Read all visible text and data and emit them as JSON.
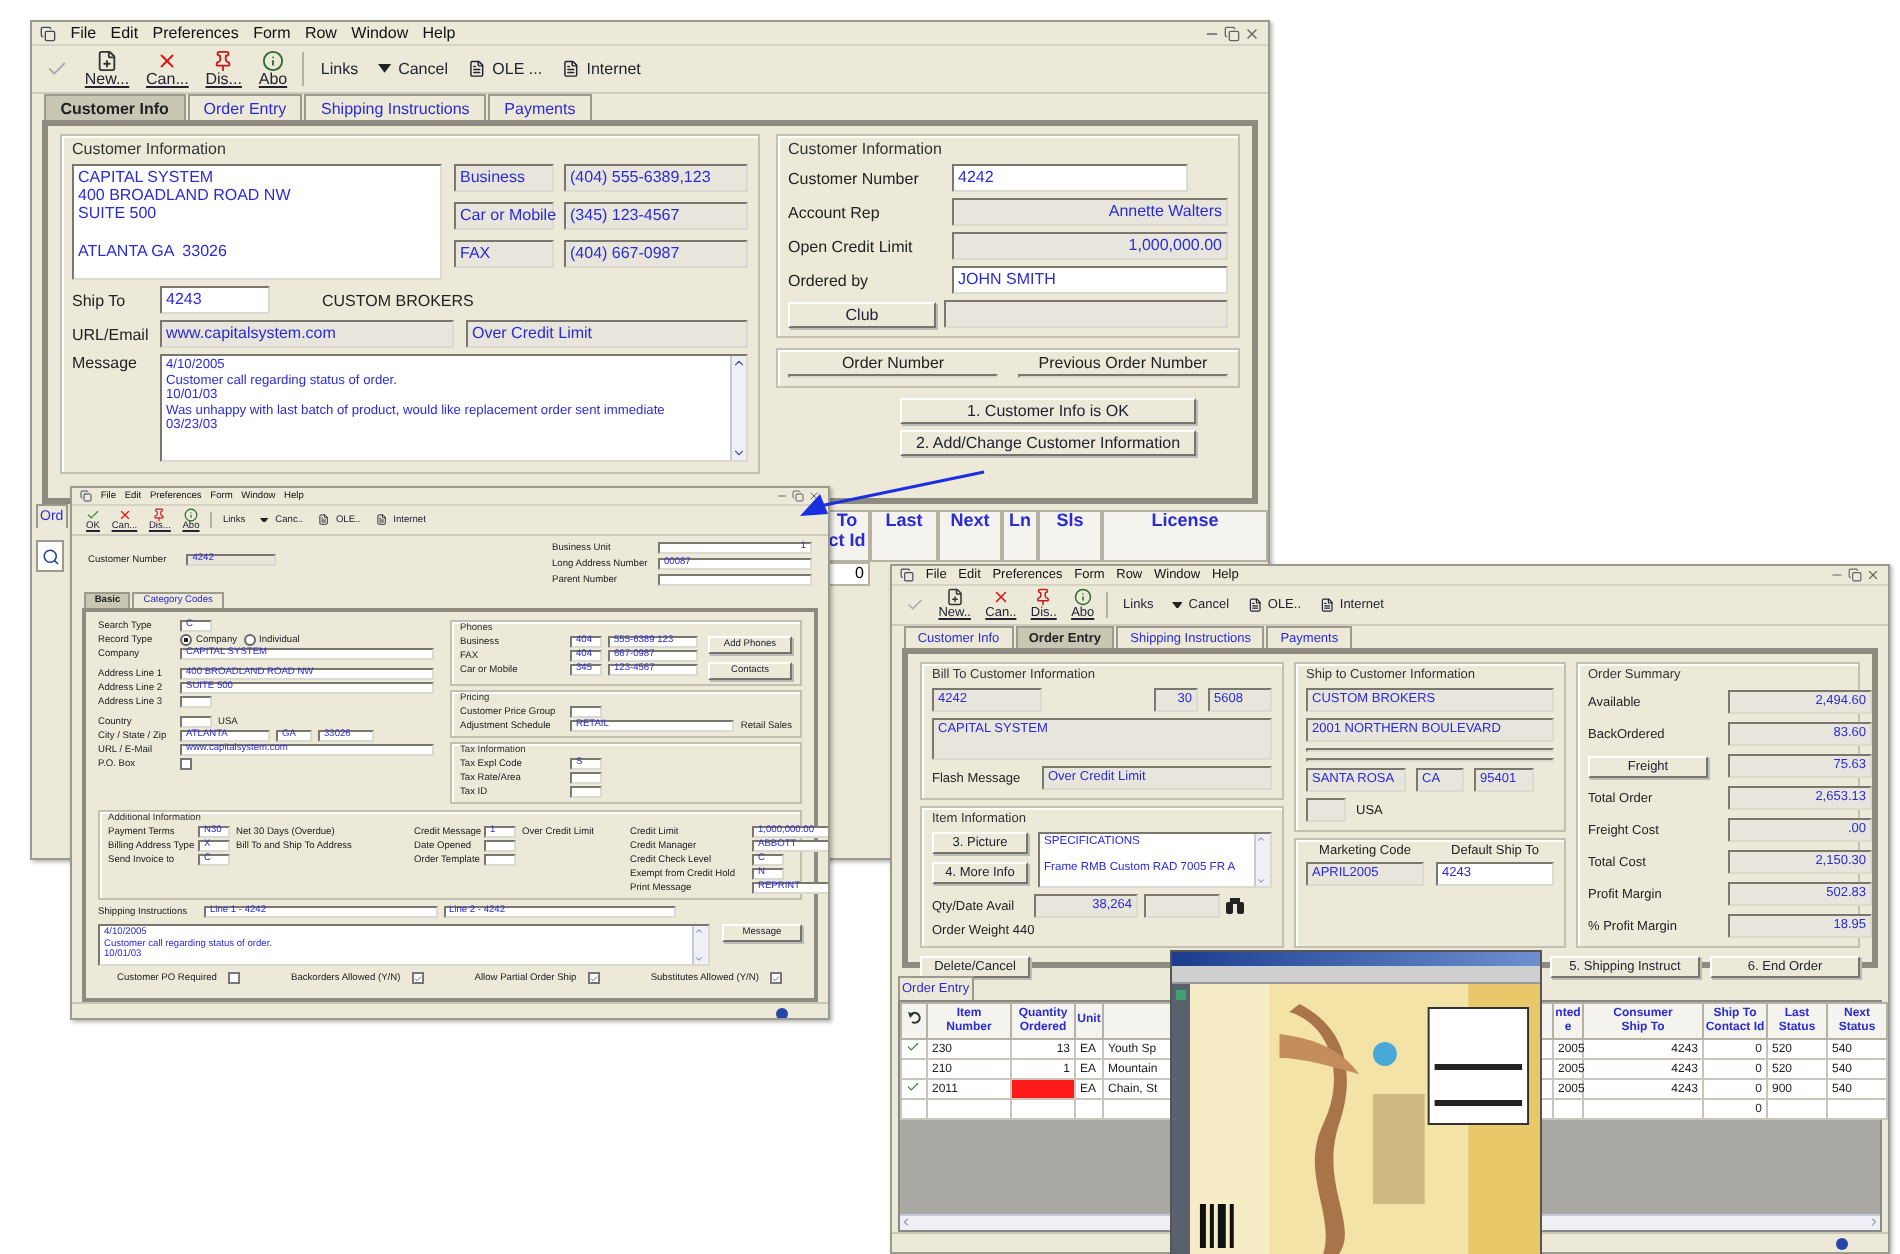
{
  "customer_window": {
    "menu": [
      "File",
      "Edit",
      "Preferences",
      "Form",
      "Row",
      "Window",
      "Help"
    ],
    "toolbar": [
      {
        "kind": "ok",
        "disabled": true
      },
      {
        "kind": "new",
        "label": "New..."
      },
      {
        "kind": "cancel",
        "label": "Can..."
      },
      {
        "kind": "display",
        "label": "Dis..."
      },
      {
        "kind": "about",
        "label": "Abo"
      }
    ],
    "links": "Links",
    "cancel": "Cancel",
    "ole": "OLE ...",
    "internet": "Internet",
    "tabs": [
      {
        "label": "Customer Info",
        "selected": true
      },
      {
        "label": "Order Entry",
        "selected": false
      },
      {
        "label": "Shipping Instructions",
        "selected": false
      },
      {
        "label": "Payments",
        "selected": false
      }
    ],
    "info": {
      "legend": "Customer Information",
      "address": [
        "CAPITAL SYSTEM",
        "400 BROADLAND ROAD NW",
        "SUITE 500"
      ],
      "city_line": "ATLANTA GA  33026",
      "phones": [
        {
          "type": "Business",
          "number": "(404) 555-6389,123"
        },
        {
          "type": "Car or Mobile",
          "number": "(345) 123-4567"
        },
        {
          "type": "FAX",
          "number": "(404) 667-0987"
        }
      ],
      "ship_to": {
        "label": "Ship To",
        "value": "4243",
        "editable": true,
        "name": "CUSTOM BROKERS"
      },
      "url": {
        "label": "URL/Email",
        "value": "www.capitalsystem.com",
        "flag": "Over Credit Limit"
      },
      "message": {
        "label": "Message",
        "lines": [
          "4/10/2005",
          "Customer call regarding status of order.",
          "10/01/03",
          "Was unhappy with last batch of product, would like replacement order sent immediate",
          "03/23/03"
        ]
      }
    },
    "account": {
      "legend": "Customer Information",
      "fields": [
        {
          "label": "Customer Number",
          "value": "4242",
          "editable": true
        },
        {
          "label": "Account Rep",
          "value": "Annette Walters",
          "editable": false
        },
        {
          "label": "Open Credit Limit",
          "value": "1,000,000.00",
          "editable": false
        },
        {
          "label": "Ordered by",
          "value": "JOHN SMITH",
          "editable": true
        }
      ],
      "club": "Club"
    },
    "order_numbers": [
      "Order Number",
      "Previous Order Number"
    ],
    "actions": [
      "1. Customer Info is OK",
      "2. Add/Change Customer Information"
    ],
    "grid": {
      "tab": "Ord",
      "columns": [
        "To\nct Id",
        "Last",
        "Next",
        "Ln",
        "Sls",
        "License"
      ],
      "value": "0"
    }
  },
  "address_window": {
    "menu": [
      "File",
      "Edit",
      "Preferences",
      "Form",
      "Window",
      "Help"
    ],
    "toolbar": [
      {
        "kind": "ok",
        "label": "OK"
      },
      {
        "kind": "cancel",
        "label": "Can..."
      },
      {
        "kind": "display",
        "label": "Dis..."
      },
      {
        "kind": "about",
        "label": "Abo"
      }
    ],
    "links": "Links",
    "cancel": "Canc..",
    "ole": "OLE..",
    "internet": "Internet",
    "header_left": [
      {
        "label": "Customer Number",
        "value": "4242"
      }
    ],
    "header_right": [
      {
        "label": "Business Unit",
        "value": "1"
      },
      {
        "label": "Long Address Number",
        "value": "00087"
      },
      {
        "label": "Parent Number"
      }
    ],
    "tabs": [
      {
        "label": "Basic",
        "selected": true
      },
      {
        "label": "Category Codes",
        "selected": false
      }
    ],
    "left_rows": [
      {
        "kind": "field",
        "label": "Search Type",
        "values": [
          "C"
        ]
      },
      {
        "kind": "radio",
        "label": "Record Type",
        "options": [
          {
            "label": "Company",
            "selected": true
          },
          {
            "label": "Individual",
            "selected": false
          }
        ]
      },
      {
        "kind": "field",
        "label": "Company",
        "values": [
          "CAPITAL SYSTEM"
        ]
      },
      {
        "kind": "field",
        "label": "Address Line 1",
        "values": [
          "400 BROADLAND ROAD NW"
        ]
      },
      {
        "kind": "field",
        "label": "Address Line 2",
        "values": [
          "SUITE 500"
        ]
      },
      {
        "kind": "field",
        "label": "Address Line 3"
      },
      {
        "kind": "field",
        "label": "Country",
        "note": "USA"
      },
      {
        "kind": "field",
        "label": "City / State / Zip",
        "values": [
          "ATLANTA",
          "GA",
          "33026"
        ]
      },
      {
        "kind": "field",
        "label": "URL / E-Mail",
        "values": [
          "www.capitalsystem.com"
        ]
      },
      {
        "kind": "check",
        "label": "P.O. Box",
        "checked": false
      }
    ],
    "groups": [
      {
        "legend": "Phones",
        "rows": [
          {
            "label": "Business",
            "values": [
              "404",
              "555-6389 123"
            ]
          },
          {
            "label": "FAX",
            "values": [
              "404",
              "667-0987"
            ]
          },
          {
            "label": "Car or Mobile",
            "values": [
              "345",
              "123-4567"
            ]
          }
        ],
        "buttons": [
          "Add Phones",
          "Contacts"
        ]
      },
      {
        "legend": "Pricing",
        "rows": [
          {
            "label": "Customer Price Group"
          },
          {
            "label": "Adjustment Schedule",
            "values": [
              "RETAIL"
            ],
            "note": "Retail Sales"
          }
        ]
      },
      {
        "legend": "Tax Information",
        "rows": [
          {
            "label": "Tax Expl Code",
            "values": [
              "S"
            ]
          },
          {
            "label": "Tax Rate/Area"
          },
          {
            "label": "Tax ID"
          }
        ]
      }
    ],
    "additional": {
      "legend": "Additional Information",
      "columns": [
        [
          {
            "label": "Payment Terms",
            "values": [
              "N30"
            ],
            "note": "Net 30 Days (Overdue)"
          },
          {
            "label": "Billing Address Type",
            "values": [
              "X"
            ],
            "note": "Bill To and Ship To Address"
          },
          {
            "label": "Send Invoice to",
            "values": [
              "C"
            ]
          }
        ],
        [
          {
            "label": "Credit Message",
            "values": [
              "1"
            ],
            "note": "Over Credit Limit"
          },
          {
            "label": "Date Opened"
          },
          {
            "label": "Order Template"
          }
        ],
        [
          {
            "label": "Credit Limit",
            "values": [
              "1,000,000.00"
            ]
          },
          {
            "label": "Credit Manager",
            "values": [
              "ABBOTT"
            ]
          },
          {
            "label": "Credit Check Level",
            "values": [
              "C"
            ]
          },
          {
            "label": "Exempt from Credit Hold",
            "values": [
              "N"
            ]
          },
          {
            "label": "Print Message",
            "values": [
              "REPRINT"
            ]
          }
        ]
      ]
    },
    "shipping": {
      "label": "Shipping Instructions",
      "values": [
        "Line 1 - 4242",
        "Line 2 - 4242"
      ]
    },
    "memo": [
      "4/10/2005",
      "Customer call regarding status of order.",
      "10/01/03"
    ],
    "message_button": "Message",
    "checks": [
      {
        "label": "Customer PO Required",
        "checked": false
      },
      {
        "label": "Backorders Allowed (Y/N)",
        "checked": true
      },
      {
        "label": "Allow Partial Order Ship",
        "checked": true
      },
      {
        "label": "Substitutes Allowed (Y/N)",
        "checked": true
      }
    ]
  },
  "order_window": {
    "menu": [
      "File",
      "Edit",
      "Preferences",
      "Form",
      "Row",
      "Window",
      "Help"
    ],
    "toolbar": [
      {
        "kind": "ok",
        "disabled": true
      },
      {
        "kind": "new",
        "label": "New.."
      },
      {
        "kind": "cancel",
        "label": "Can.."
      },
      {
        "kind": "display",
        "label": "Dis.."
      },
      {
        "kind": "about",
        "label": "Abo"
      }
    ],
    "links": "Links",
    "cancel": "Cancel",
    "ole": "OLE..",
    "internet": "Internet",
    "tabs": [
      {
        "label": "Customer Info",
        "selected": false
      },
      {
        "label": "Order Entry",
        "selected": true
      },
      {
        "label": "Shipping Instructions",
        "selected": false
      },
      {
        "label": "Payments",
        "selected": false
      }
    ],
    "bill_to": {
      "legend": "Bill To Customer Information",
      "number": "4242",
      "codes": [
        "30",
        "5608"
      ],
      "name": "CAPITAL SYSTEM",
      "flash_label": "Flash Message",
      "flash": "Over Credit Limit"
    },
    "item": {
      "legend": "Item Information",
      "buttons": [
        "3. Picture",
        "4. More Info"
      ],
      "spec": [
        "SPECIFICATIONS",
        "Frame RMB Custom RAD 7005 FR A"
      ],
      "qty_label": "Qty/Date Avail",
      "qty": "38,264",
      "weight": "Order Weight  440"
    },
    "ship_to": {
      "legend": "Ship to Customer Information",
      "lines": [
        "CUSTOM BROKERS",
        "2001 NORTHERN BOULEVARD"
      ],
      "city": [
        "SANTA ROSA",
        "CA",
        "95401"
      ],
      "country": "USA"
    },
    "marketing": [
      {
        "label": "Marketing Code",
        "value": "APRIL2005",
        "editable": false
      },
      {
        "label": "Default Ship To",
        "value": "4243",
        "editable": true
      }
    ],
    "summary": {
      "legend": "Order Summary",
      "rows": [
        {
          "kind": "text",
          "label": "Available",
          "value": "2,494.60"
        },
        {
          "kind": "text",
          "label": "BackOrdered",
          "value": "83.60"
        },
        {
          "kind": "button",
          "label": "Freight",
          "value": "75.63"
        },
        {
          "kind": "text",
          "label": "Total Order",
          "value": "2,653.13"
        },
        {
          "kind": "text",
          "label": "Freight Cost",
          "value": ".00"
        },
        {
          "kind": "text",
          "label": "Total Cost",
          "value": "2,150.30"
        },
        {
          "kind": "text",
          "label": "Profit Margin",
          "value": "502.83"
        },
        {
          "kind": "text",
          "label": "% Profit Margin",
          "value": "18.95"
        }
      ]
    },
    "buttons": [
      "Delete/Cancel",
      "5. Shipping Instruct",
      "6. End Order"
    ],
    "grid_tab": "Order Entry",
    "columns": [
      {
        "label": "Item\nNumber"
      },
      {
        "label": "Quantity\nOrdered"
      },
      {
        "label": "Unit"
      },
      {},
      {
        "label": "nted\ne"
      },
      {
        "label": "Consumer\nShip To"
      },
      {
        "label": "Ship To\nContact Id"
      },
      {
        "label": "Last\nStatus"
      },
      {
        "label": "Next\nStatus"
      }
    ],
    "rows": [
      {
        "checked": true,
        "error": false,
        "cells": [
          "230",
          "13",
          "EA",
          "Youth Sp",
          "2005",
          "4243",
          "0",
          "520",
          "540"
        ]
      },
      {
        "checked": false,
        "error": false,
        "cells": [
          "210",
          "1",
          "EA",
          "Mountain",
          "2005",
          "4243",
          "0",
          "520",
          "540"
        ]
      },
      {
        "checked": true,
        "error": true,
        "cells": [
          "2011",
          null,
          "EA",
          "Chain, St",
          "2005",
          "4243",
          "0",
          "900",
          "540"
        ]
      },
      {
        "checked": false,
        "error": false,
        "cells": [
          null,
          null,
          null,
          null,
          null,
          null,
          "0",
          null,
          null
        ]
      }
    ]
  }
}
